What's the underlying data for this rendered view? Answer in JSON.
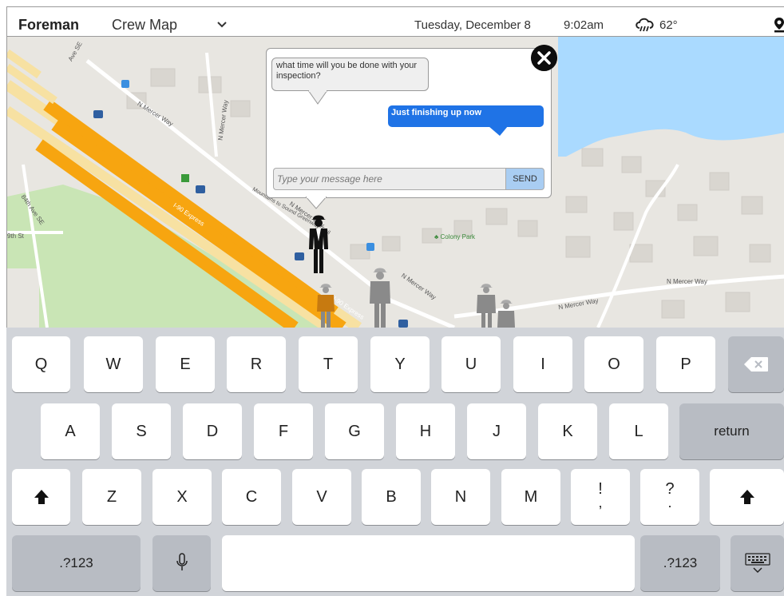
{
  "header": {
    "brand": "Foreman",
    "view_title": "Crew Map",
    "date": "Tuesday, December 8",
    "time": "9:02am",
    "temperature": "62°",
    "icons": [
      "chevron-down-icon",
      "rain-cloud-icon",
      "location-pin-icon"
    ]
  },
  "map": {
    "labels": {
      "mercer_way_1": "N Mercer Way",
      "mercer_way_vertical": "N Mercer Way",
      "mercer_way_2": "N Mercer Way",
      "mercer_way_3": "N Mercer Way",
      "mercer_way_4": "N Mercer Way",
      "mercer_way_5": "N Mercer Way",
      "i90_express_1": "I-90 Express",
      "i90_express_2": "I-90 Express",
      "mountains_trail": "Mountains to Sound Greenway Trail",
      "colony_park": "Colony Park",
      "ave_84th": "84th Ave SE",
      "ave_top": "Ave SE",
      "street_9th": "9th St"
    }
  },
  "chat": {
    "incoming_message": "what time will you be done with your inspection?",
    "outgoing_message": "Just finishing up now",
    "input_placeholder": "Type your message here",
    "send_label": "SEND"
  },
  "keyboard": {
    "row1": [
      "Q",
      "W",
      "E",
      "R",
      "T",
      "Y",
      "U",
      "I",
      "O",
      "P"
    ],
    "row2": [
      "A",
      "S",
      "D",
      "F",
      "G",
      "H",
      "J",
      "K",
      "L"
    ],
    "return_label": "return",
    "row3": [
      "Z",
      "X",
      "C",
      "V",
      "B",
      "N",
      "M"
    ],
    "punct1_top": "!",
    "punct1_bottom": ",",
    "punct2_top": "?",
    "punct2_bottom": ".",
    "numbers_label": ".?123"
  },
  "colors": {
    "accent_blue": "#1f73e6",
    "send_button": "#a9cdf2",
    "highway_orange": "#f7a510",
    "water": "#aadaff",
    "park": "#c9e5b5"
  }
}
